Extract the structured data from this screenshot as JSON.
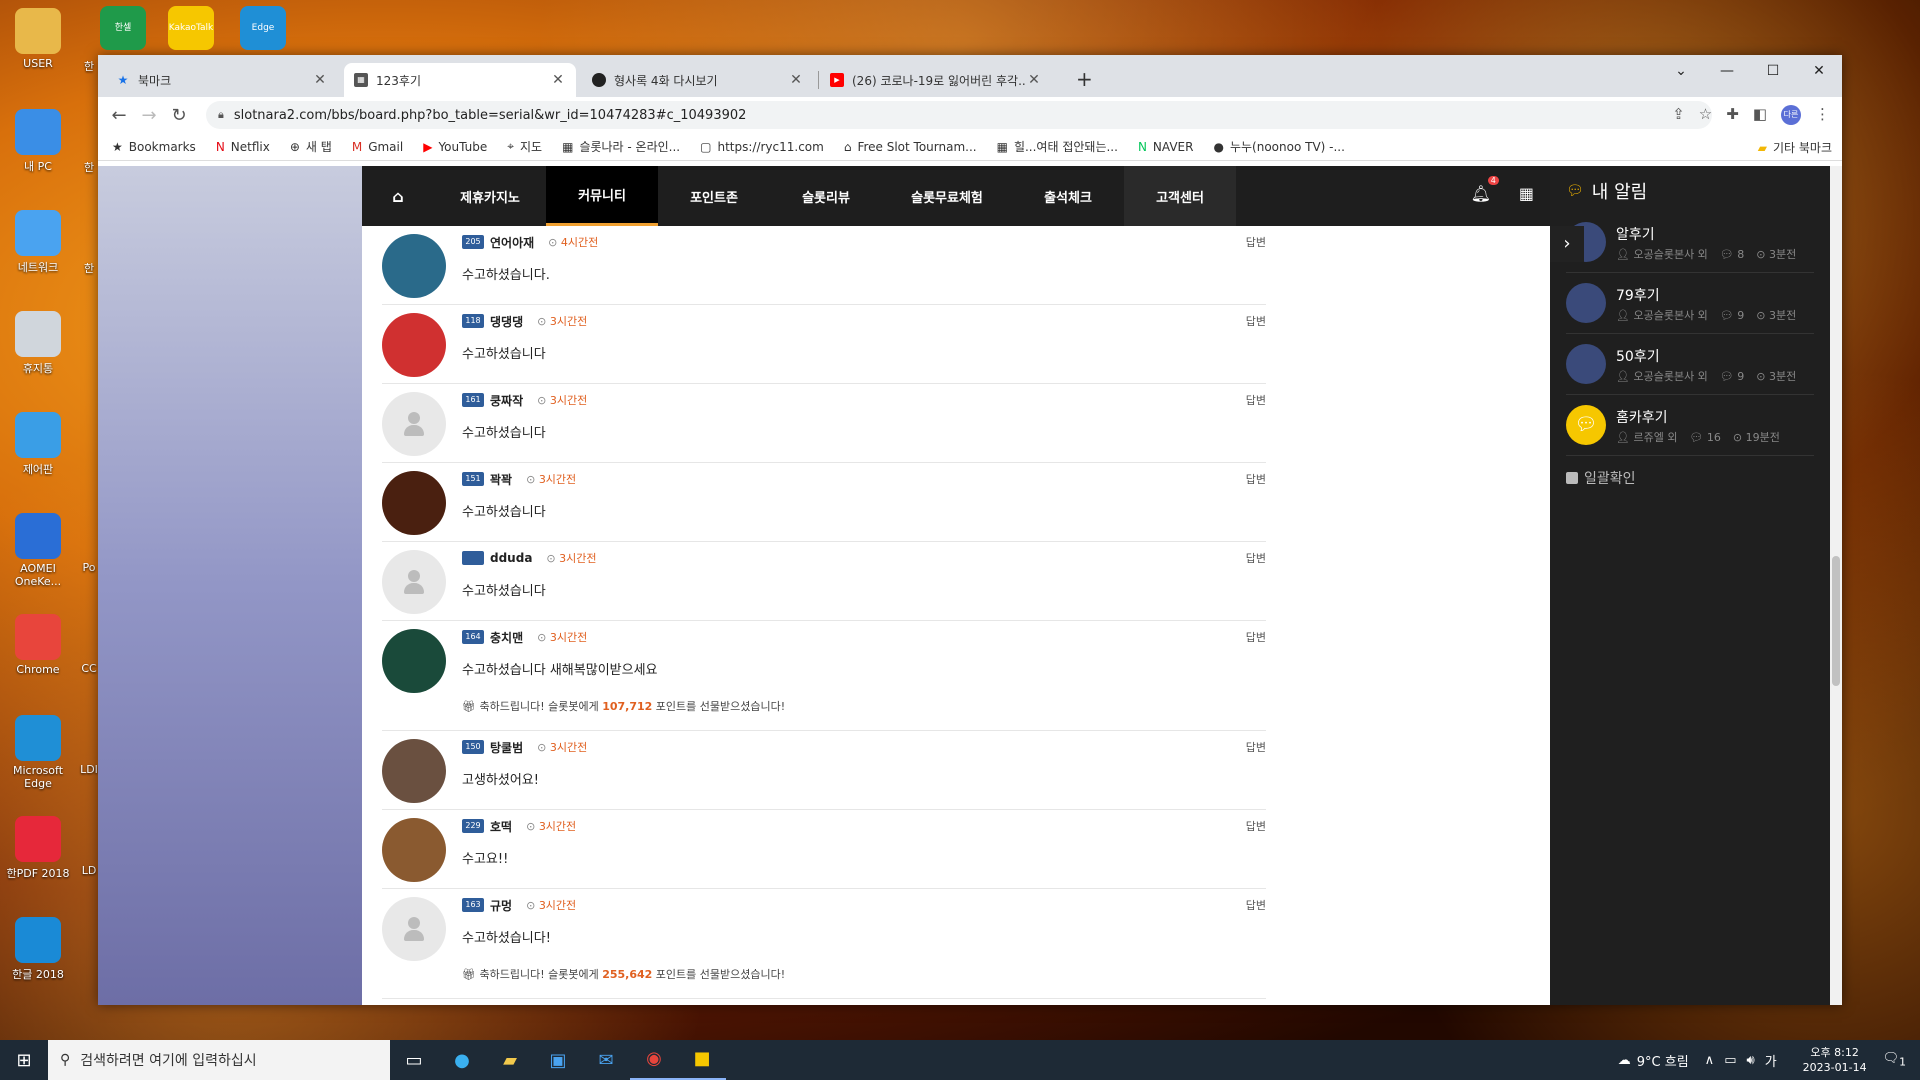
{
  "desktop": {
    "icons": [
      {
        "label": "USER",
        "color": "#e8b84a"
      },
      {
        "label": "내 PC",
        "color": "#3a8ee6"
      },
      {
        "label": "네트워크",
        "color": "#4aa3f0"
      },
      {
        "label": "휴지통",
        "color": "#d0d6dc"
      },
      {
        "label": "제어판",
        "color": "#3a9ee6"
      },
      {
        "label": "AOMEI OneKe...",
        "color": "#2a6ed6"
      },
      {
        "label": "Chrome",
        "color": "#e8453c"
      },
      {
        "label": "Microsoft Edge",
        "color": "#1f8fd6"
      },
      {
        "label": "한PDF 2018",
        "color": "#e6283a"
      },
      {
        "label": "한글 2018",
        "color": "#1a8ad6"
      }
    ],
    "partial_labels": [
      "한",
      "한",
      "한",
      "Po",
      "CC",
      "LDI",
      "LD"
    ],
    "top_icons": [
      "한셀",
      "KakaoTalk",
      "Edge"
    ]
  },
  "browser": {
    "tabs": [
      {
        "label": "북마크",
        "icon": "star-icon"
      },
      {
        "label": "123후기",
        "icon": "site-icon"
      },
      {
        "label": "형사록 4화 다시보기",
        "icon": "dark-circle-icon"
      },
      {
        "label": "(26) 코로나-19로 잃어버린 후각...",
        "icon": "youtube-icon"
      }
    ],
    "active_tab": 1,
    "url": "slotnara2.com/bbs/board.php?bo_table=serial&wr_id=10474283#c_10493902",
    "profile_label": "다른",
    "bookmarks": [
      {
        "label": "Bookmarks",
        "icon": "★"
      },
      {
        "label": "Netflix",
        "icon": "N"
      },
      {
        "label": "새 탭",
        "icon": "⊕"
      },
      {
        "label": "Gmail",
        "icon": "M"
      },
      {
        "label": "YouTube",
        "icon": "▶"
      },
      {
        "label": "지도",
        "icon": "⌖"
      },
      {
        "label": "슬롯나라 - 온라인...",
        "icon": "▦"
      },
      {
        "label": "https://ryc11.com",
        "icon": "▢"
      },
      {
        "label": "Free Slot Tournam...",
        "icon": "⌂"
      },
      {
        "label": "힐...여태 접안돼는...",
        "icon": "▦"
      },
      {
        "label": "NAVER",
        "icon": "N"
      },
      {
        "label": "누누(noonoo TV) -...",
        "icon": "●"
      }
    ],
    "other_bookmarks": "기타 북마크"
  },
  "site": {
    "nav": [
      "제휴카지노",
      "커뮤니티",
      "포인트존",
      "슬롯리뷰",
      "슬롯무료체험",
      "출석체크",
      "고객센터"
    ],
    "active_nav": 1,
    "bell_count": "4",
    "reply_label": "답변",
    "comments": [
      {
        "nick": "연어아재",
        "level": "205",
        "time": "4시간전",
        "text": "수고하셨습니다.",
        "avatar": "#2a6a8a"
      },
      {
        "nick": "댕댕댕",
        "level": "118",
        "time": "3시간전",
        "text": "수고하셨습니다",
        "avatar": "#d03030"
      },
      {
        "nick": "쿵짜작",
        "level": "161",
        "time": "3시간전",
        "text": "수고하셨습니다",
        "avatar": ""
      },
      {
        "nick": "꽉꽉",
        "level": "151",
        "time": "3시간전",
        "text": "수고하셨습니다",
        "avatar": "#4a2010"
      },
      {
        "nick": "dduda",
        "level": "",
        "time": "3시간전",
        "text": "수고하셨습니다",
        "avatar": ""
      },
      {
        "nick": "충치맨",
        "level": "164",
        "time": "3시간전",
        "text": "수고하셨습니다 새해복많이받으세요",
        "avatar": "#1a4a3a",
        "gift_pre": "축하드립니다! 슬롯봇에게 ",
        "gift_amount": "107,712",
        "gift_post": " 포인트를 선물받으셨습니다!"
      },
      {
        "nick": "탕쿨범",
        "level": "150",
        "time": "3시간전",
        "text": "고생하셨어요!",
        "avatar": "#6a5040"
      },
      {
        "nick": "호떡",
        "level": "229",
        "time": "3시간전",
        "text": "수고요!!",
        "avatar": "#8a5a30"
      },
      {
        "nick": "규멍",
        "level": "163",
        "time": "3시간전",
        "text": "수고하셨습니다!",
        "avatar": "",
        "gift_pre": "축하드립니다! 슬롯봇에게 ",
        "gift_amount": "255,642",
        "gift_post": " 포인트를 선물받으셨습니다!"
      }
    ],
    "side": {
      "title": "내 알림",
      "items": [
        {
          "title": "알후기",
          "author": "오공슬롯본사 외",
          "comments": "8",
          "time": "3분전"
        },
        {
          "title": "79후기",
          "author": "오공슬롯본사 외",
          "comments": "9",
          "time": "3분전"
        },
        {
          "title": "50후기",
          "author": "오공슬롯본사 외",
          "comments": "9",
          "time": "3분전"
        },
        {
          "title": "홈카후기",
          "author": "르쥬엘 외",
          "comments": "16",
          "time": "19분전"
        }
      ],
      "check_all": "일괄확인"
    }
  },
  "taskbar": {
    "search_placeholder": "검색하려면 여기에 입력하십시",
    "weather": "9°C 흐림",
    "time": "오후 8:12",
    "date": "2023-01-14",
    "notif_count": "1"
  }
}
